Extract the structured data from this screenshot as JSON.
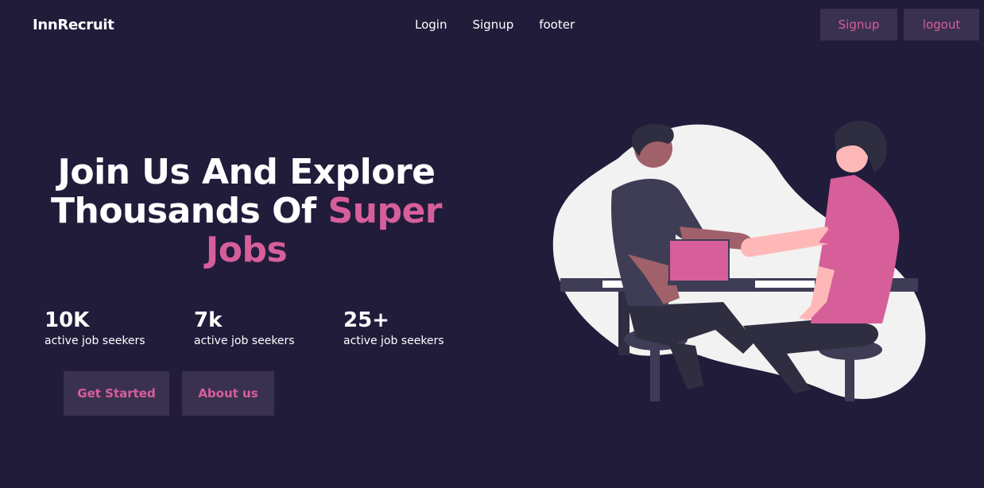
{
  "nav": {
    "brand": "InnRecruit",
    "links": [
      "Login",
      "Signup",
      "footer"
    ],
    "signup_button": "Signup",
    "logout_button": "logout"
  },
  "hero": {
    "title_line1": "Join Us And Explore",
    "title_line2_prefix": "Thousands Of ",
    "title_line2_accent": "Super",
    "title_line3_accent": "Jobs",
    "stats": [
      {
        "value": "10K",
        "label": "active job seekers"
      },
      {
        "value": "7k",
        "label": "active job seekers"
      },
      {
        "value": "25+",
        "label": "active job seekers"
      }
    ],
    "get_started": "Get Started",
    "about_us": "About us"
  },
  "colors": {
    "background": "#221c3b",
    "accent": "#d65f9a",
    "button_bg": "#3a3150",
    "blob": "#f2f2f2"
  },
  "illustration": {
    "icon": "handshake-illustration"
  }
}
